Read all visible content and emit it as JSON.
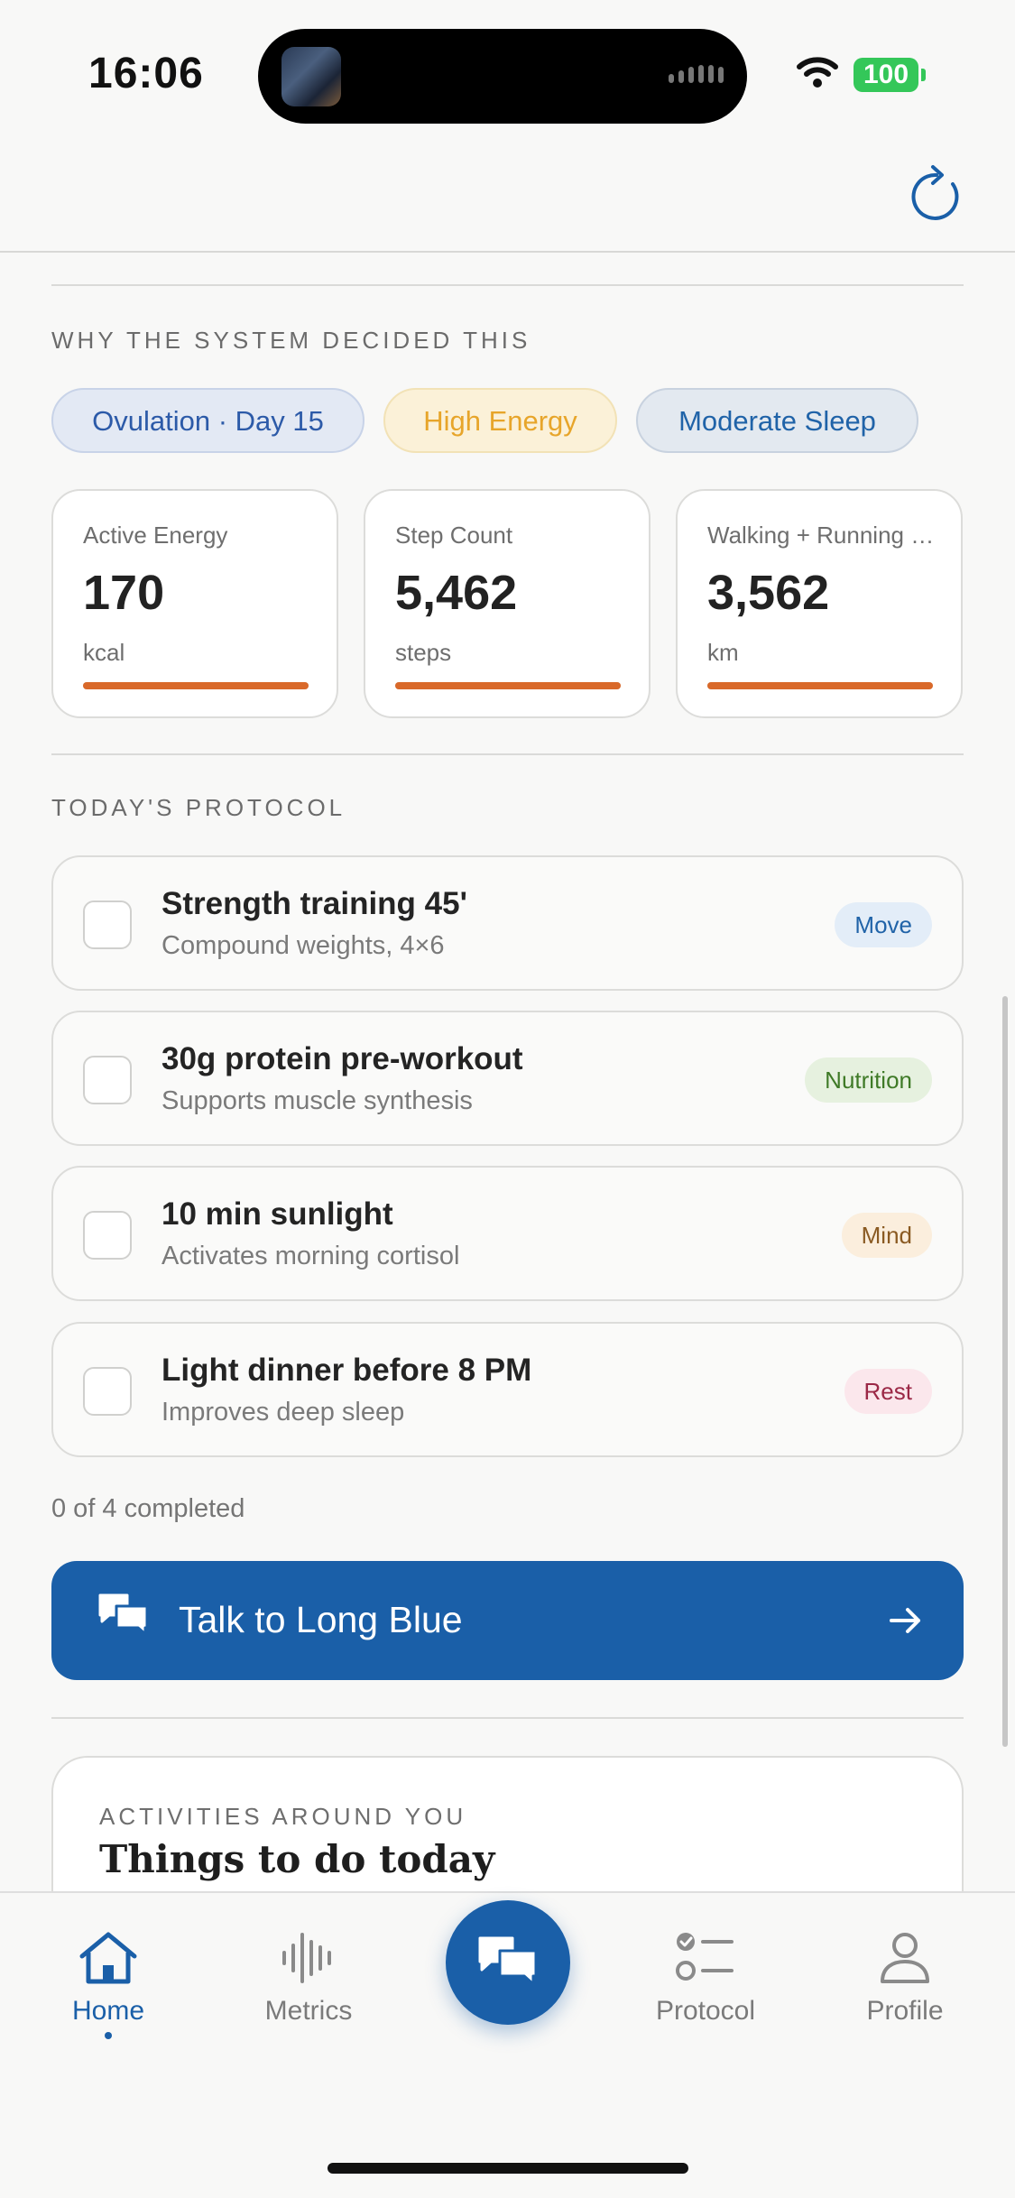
{
  "status_bar": {
    "time": "16:06",
    "battery": "100"
  },
  "reasons": {
    "label": "WHY THE SYSTEM DECIDED THIS",
    "chips": [
      "Ovulation · Day 15",
      "High Energy",
      "Moderate Sleep"
    ]
  },
  "metrics": [
    {
      "title": "Active Energy",
      "value": "170",
      "unit": "kcal"
    },
    {
      "title": "Step Count",
      "value": "5,462",
      "unit": "steps"
    },
    {
      "title": "Walking + Running Distance",
      "value": "3,562",
      "unit": "km"
    }
  ],
  "protocol": {
    "label": "TODAY'S PROTOCOL",
    "tasks": [
      {
        "title": "Strength training 45'",
        "subtitle": "Compound weights, 4×6",
        "tag": "Move"
      },
      {
        "title": "30g protein pre-workout",
        "subtitle": "Supports muscle synthesis",
        "tag": "Nutrition"
      },
      {
        "title": "10 min sunlight",
        "subtitle": "Activates morning cortisol",
        "tag": "Mind"
      },
      {
        "title": "Light dinner before 8 PM",
        "subtitle": "Improves deep sleep",
        "tag": "Rest"
      }
    ],
    "completed_text": "0 of 4 completed"
  },
  "cta": {
    "label": "Talk to Long Blue"
  },
  "activities": {
    "label": "ACTIVITIES AROUND YOU",
    "title": "Things to do today"
  },
  "tabbar": {
    "home": "Home",
    "metrics": "Metrics",
    "protocol": "Protocol",
    "profile": "Profile"
  },
  "colors": {
    "accent": "#1a5fa8",
    "metric_bar": "#d9692a"
  }
}
